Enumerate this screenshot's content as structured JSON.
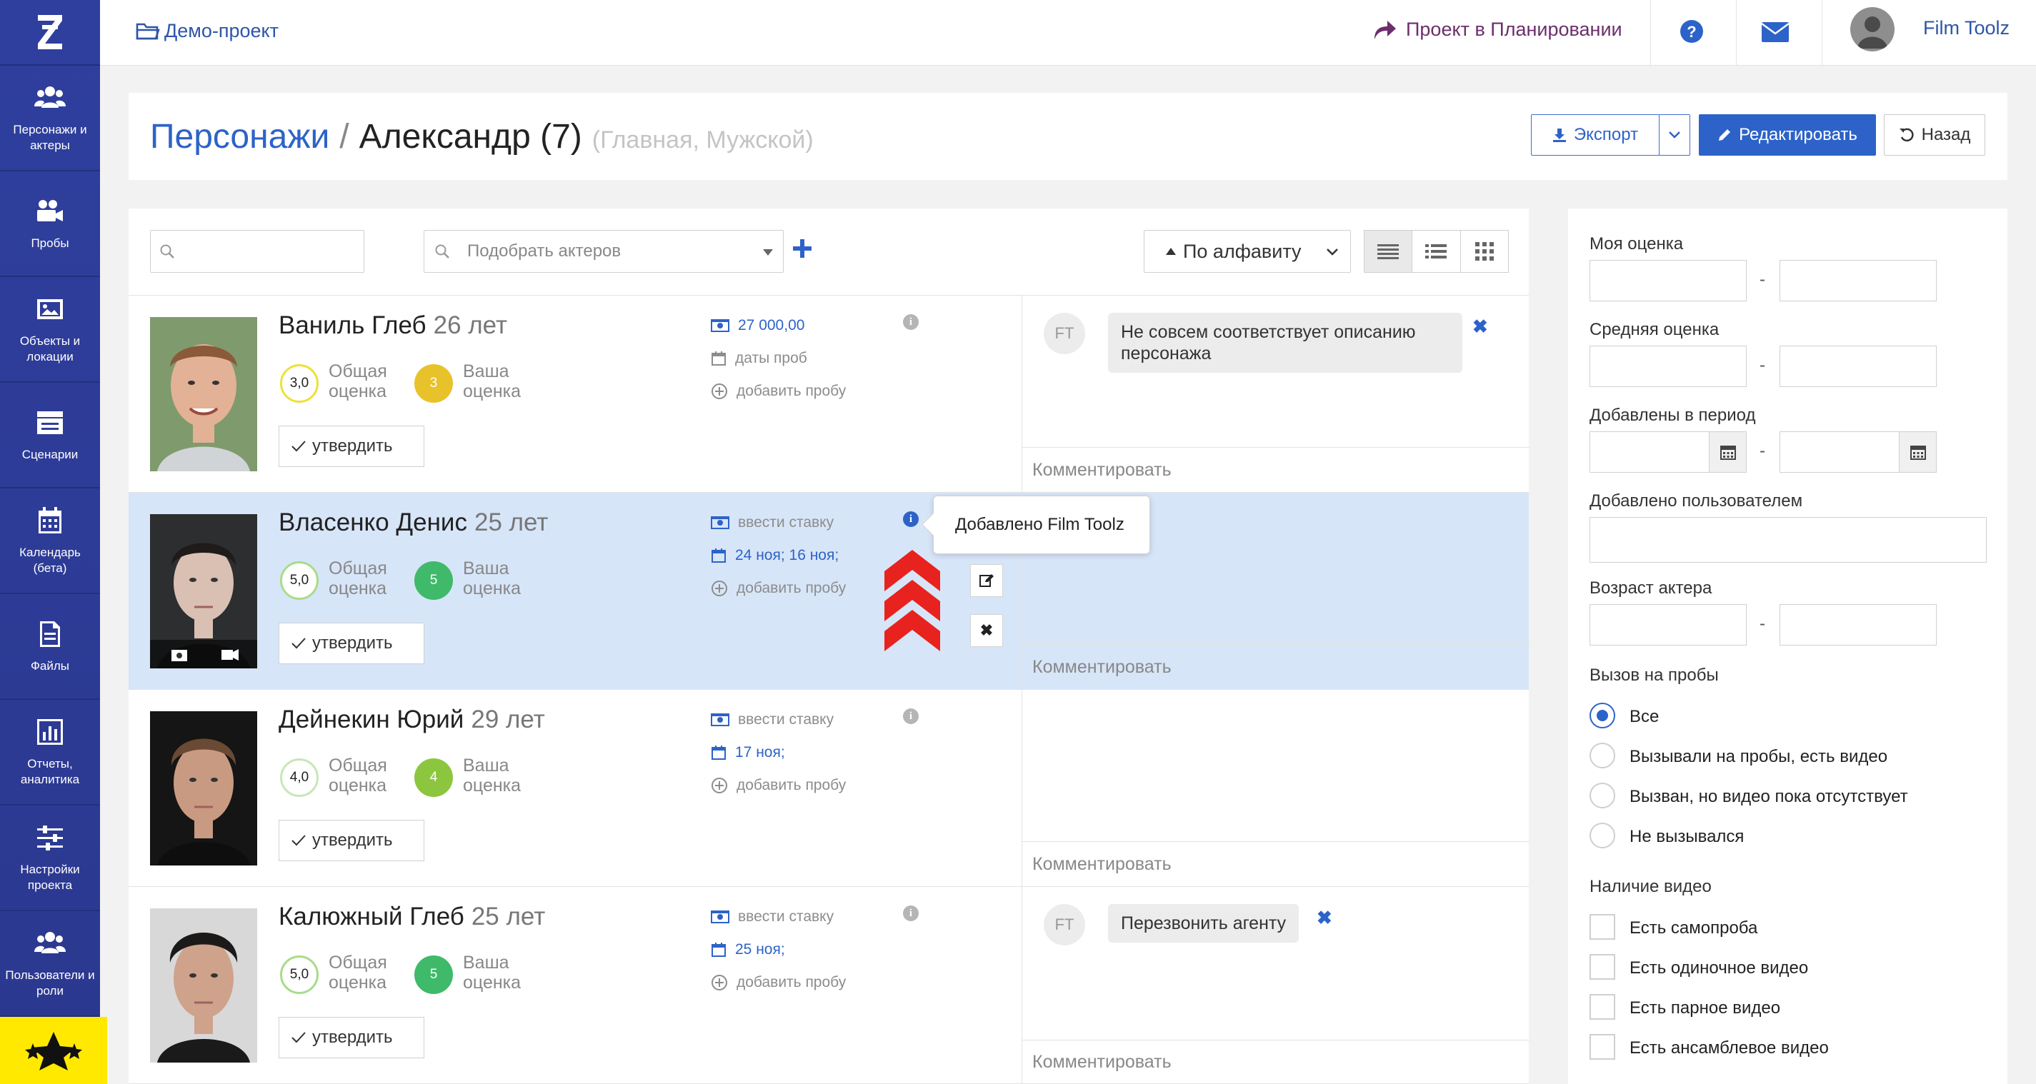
{
  "sidebar": {
    "items": [
      {
        "label": "Персонажи и актеры",
        "icon": "people-icon"
      },
      {
        "label": "Пробы",
        "icon": "camera-icon"
      },
      {
        "label": "Объекты и локации",
        "icon": "image-icon"
      },
      {
        "label": "Сценарии",
        "icon": "clapperboard-icon"
      },
      {
        "label": "Календарь (бета)",
        "icon": "calendar-icon"
      },
      {
        "label": "Файлы",
        "icon": "file-icon"
      },
      {
        "label": "Отчеты, аналитика",
        "icon": "chart-icon"
      },
      {
        "label": "Настройки проекта",
        "icon": "sliders-icon"
      },
      {
        "label": "Пользователи и роли",
        "icon": "users-icon"
      }
    ]
  },
  "topbar": {
    "project": "Демо-проект",
    "status": "Проект в Планировании",
    "user": "Film Toolz"
  },
  "header": {
    "crumb": "Персонажи",
    "separator": "/",
    "name": "Александр (7)",
    "subtitle": "(Главная, Мужской)",
    "export_label": "Экспорт",
    "edit_label": "Редактировать",
    "back_label": "Назад"
  },
  "toolbar": {
    "actor_placeholder": "Подобрать актеров",
    "sort_label": "По алфавиту"
  },
  "actors": [
    {
      "name": "Ваниль Глеб",
      "age": "26 лет",
      "overall": "3,0",
      "mine": "3",
      "mine_color": "#e8c22a",
      "overall_label": "Общая оценка",
      "mine_label": "Ваша оценка",
      "approve": "утвердить",
      "rate": "27 000,00",
      "dates": "даты проб",
      "add": "добавить пробу",
      "comment_placeholder": "Комментировать"
    },
    {
      "name": "Власенко Денис",
      "age": "25 лет",
      "overall": "5,0",
      "mine": "5",
      "mine_color": "#3fba6a",
      "overall_label": "Общая оценка",
      "mine_label": "Ваша оценка",
      "approve": "утвердить",
      "rate": "ввести ставку",
      "dates": "24 ноя; 16 ноя;",
      "add": "добавить пробу",
      "comment_placeholder": "Комментировать"
    },
    {
      "name": "Дейнекин Юрий",
      "age": "29 лет",
      "overall": "4,0",
      "mine": "4",
      "mine_color": "#8cc63f",
      "overall_label": "Общая оценка",
      "mine_label": "Ваша оценка",
      "approve": "утвердить",
      "rate": "ввести ставку",
      "dates": "17 ноя;",
      "add": "добавить пробу",
      "comment_placeholder": "Комментировать"
    },
    {
      "name": "Калюжный Глеб",
      "age": "25 лет",
      "overall": "5,0",
      "mine": "5",
      "mine_color": "#3fba6a",
      "overall_label": "Общая оценка",
      "mine_label": "Ваша оценка",
      "approve": "утвердить",
      "rate": "ввести ставку",
      "dates": "25 ноя;",
      "add": "добавить пробу",
      "comment_placeholder": "Комментировать"
    }
  ],
  "comments": {
    "avatar": "FT",
    "first": "Не совсем соответствует описанию персонажа",
    "fourth": "Перезвонить агенту"
  },
  "tooltip": "Добавлено Film Toolz",
  "filters": {
    "my_rating": "Моя оценка",
    "avg_rating": "Средняя оценка",
    "added_period": "Добавлены в период",
    "added_by": "Добавлено пользователем",
    "actor_age": "Возраст актера",
    "audition_call": "Вызов на пробы",
    "call_options": [
      "Все",
      "Вызывали на пробы, есть видео",
      "Вызван, но видео пока отсутствует",
      "Не вызывался"
    ],
    "video_presence": "Наличие видео",
    "video_options": [
      "Есть самопроба",
      "Есть одиночное видео",
      "Есть парное видео",
      "Есть ансамблевое видео"
    ],
    "dash": "-"
  }
}
